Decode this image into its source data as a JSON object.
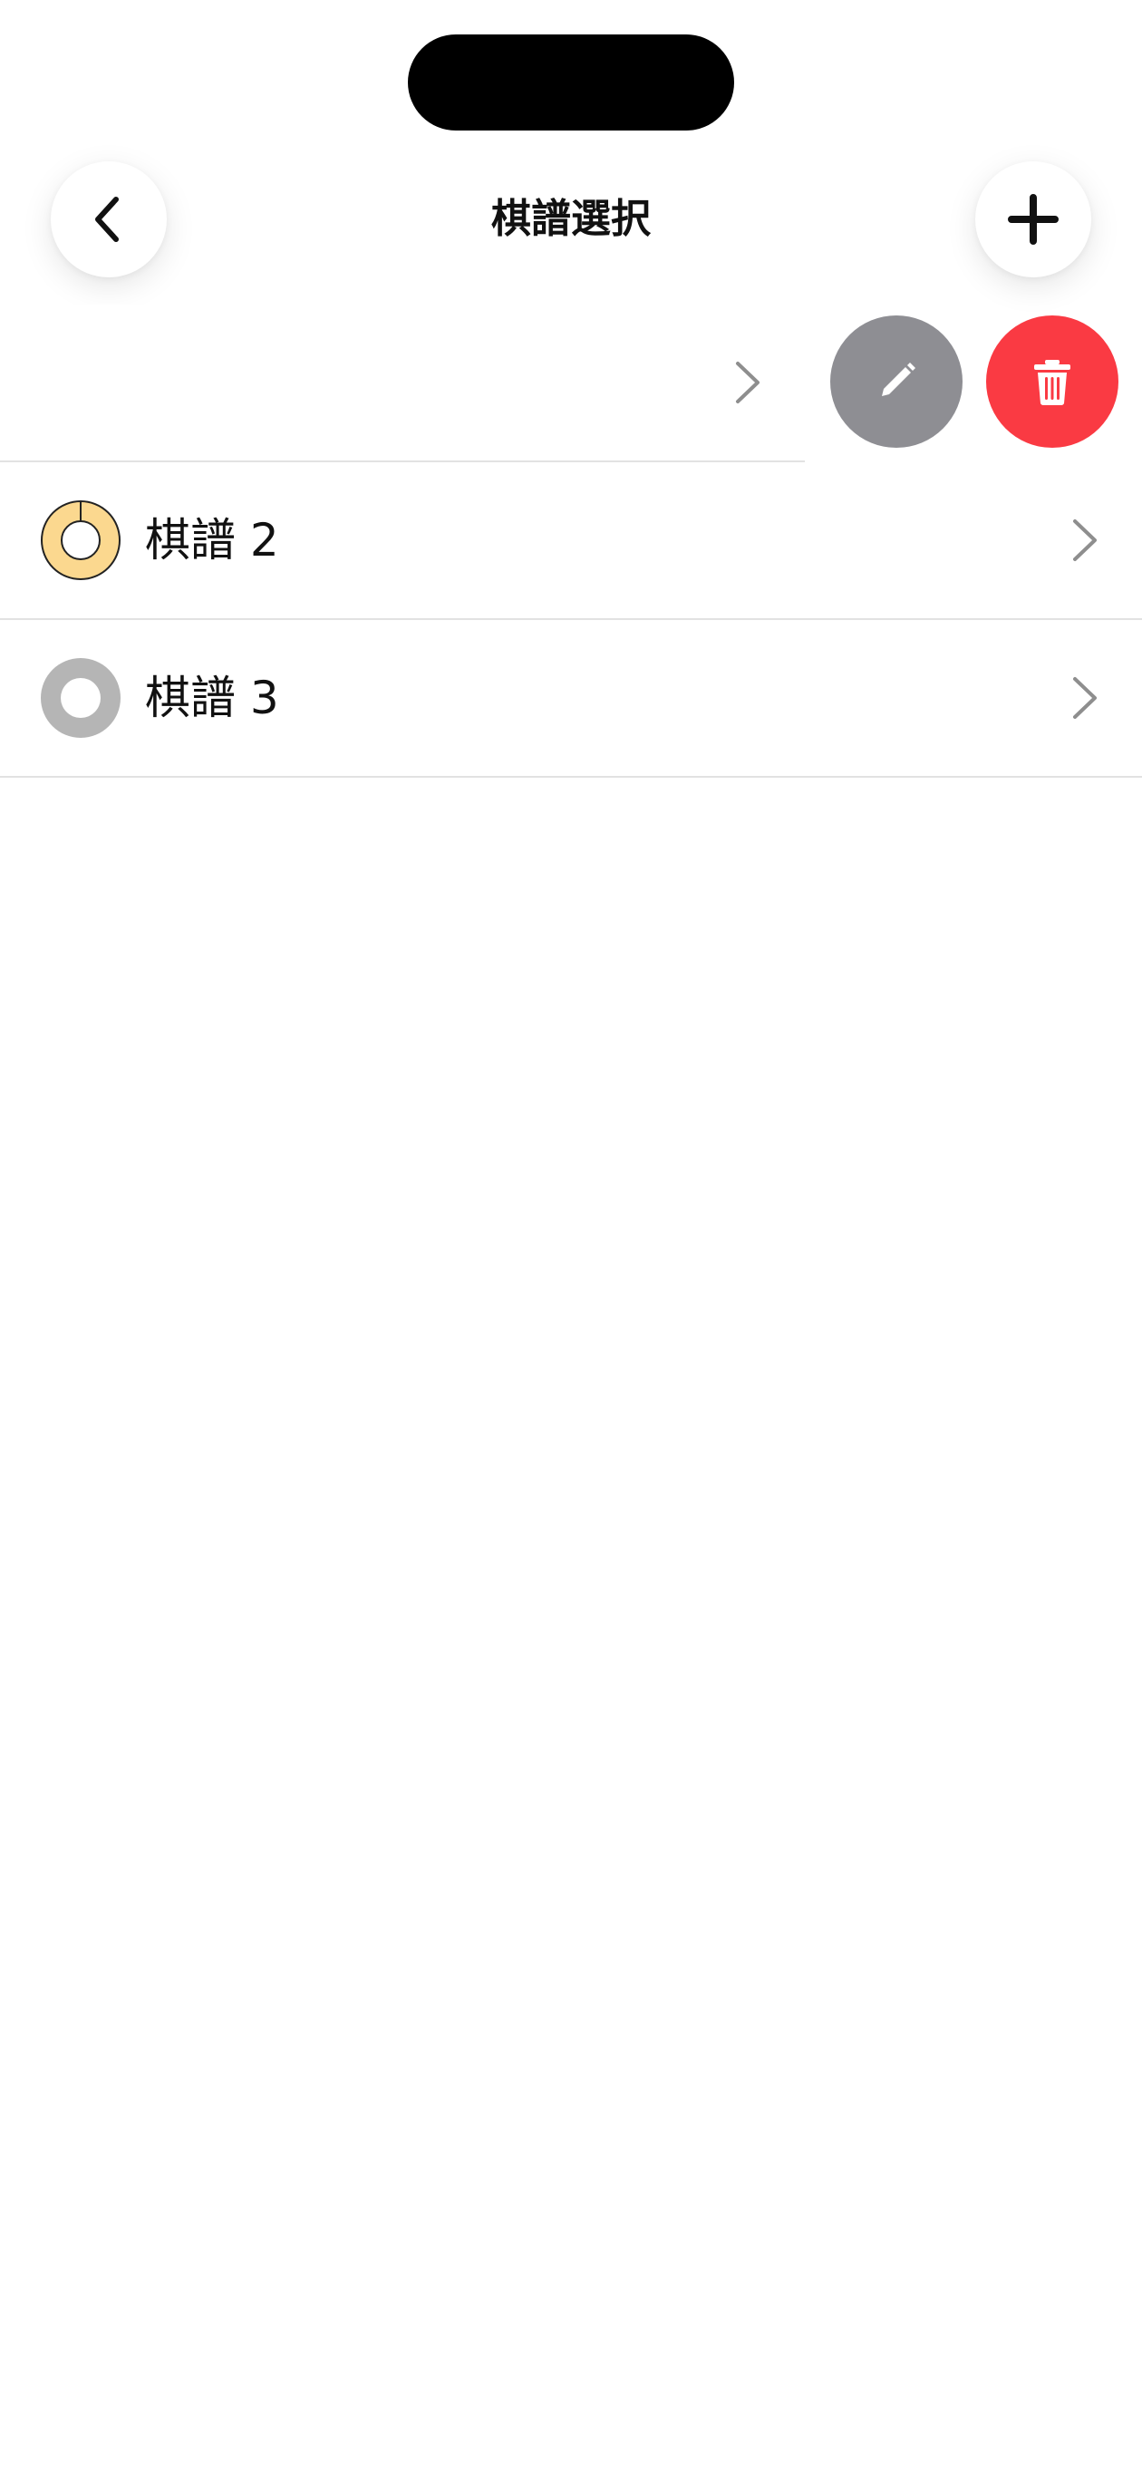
{
  "header": {
    "title": "棋譜選択",
    "back_icon": "chevron-left-icon",
    "add_icon": "plus-icon"
  },
  "records": [
    {
      "label": "",
      "status": "hidden-under-swipe",
      "swiped": true
    },
    {
      "label": "棋譜 2",
      "status": "in-progress",
      "progress": 0.0
    },
    {
      "label": "棋譜 3",
      "status": "unstarted"
    }
  ],
  "swipe_actions": {
    "edit_icon": "pencil-icon",
    "delete_icon": "trash-icon"
  },
  "colors": {
    "edit_button": "#8e8e93",
    "delete_button": "#fa3a43",
    "in_progress_ring": "#fbd88f",
    "unstarted_ring": "#b5b5b5",
    "chevron": "#8e8e8e",
    "divider": "#e2e2e2"
  }
}
